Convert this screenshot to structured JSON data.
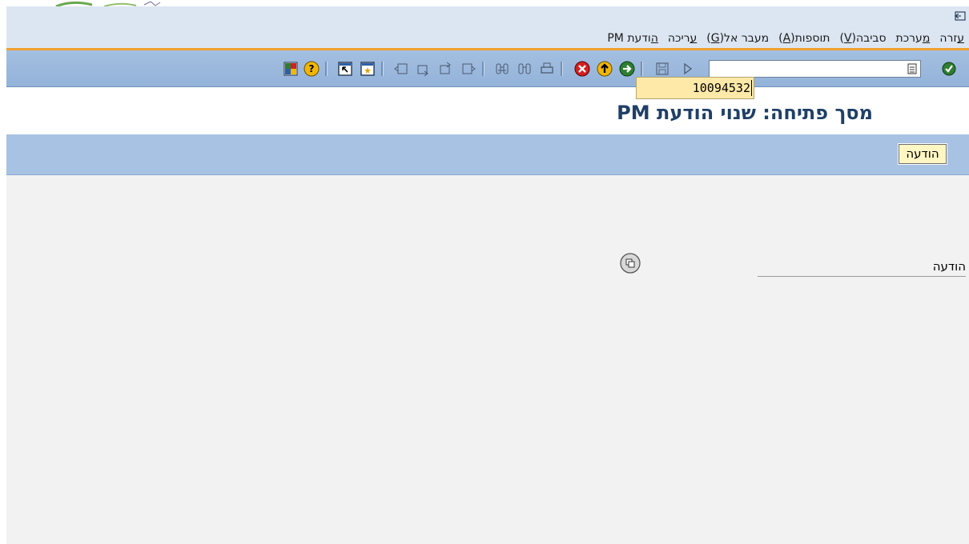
{
  "menu": {
    "items": [
      {
        "pre": "",
        "ul": "ה",
        "post": "ודעת PM"
      },
      {
        "pre": "",
        "ul": "ע",
        "post": "ריכה"
      },
      {
        "pre": "מעבר אל(",
        "ul": "G",
        "post": ")"
      },
      {
        "pre": "תוספות(",
        "ul": "A",
        "post": ")"
      },
      {
        "pre": "סביבה(",
        "ul": "V",
        "post": ")"
      },
      {
        "pre": "",
        "ul": "מ",
        "post": "ערכת"
      },
      {
        "pre": "",
        "ul": "ע",
        "post": "זרה"
      }
    ]
  },
  "toolbar": {
    "command_value": "",
    "icons": [
      "enter-icon",
      "command-dropdown-icon",
      "play-icon",
      "save-icon",
      "back-icon",
      "exit-icon",
      "cancel-icon",
      "print-icon",
      "find-icon",
      "find-next-icon",
      "first-page-icon",
      "previous-page-icon",
      "next-page-icon",
      "last-page-icon",
      "create-session-icon",
      "shortcut-icon",
      "help-icon",
      "customize-layout-icon"
    ]
  },
  "title": "מסך פתיחה: שנוי הודעת PM",
  "app_toolbar": {
    "notification_button": "הודעה"
  },
  "form": {
    "notification_label": "הודעה",
    "notification_value": "10094532"
  },
  "colors": {
    "menu_bg": "#dce6f2",
    "toolbar_bg": "#a3bfe0",
    "accent_line": "#f0a030",
    "title_color": "#1f3f66",
    "input_bg": "#ffe9a8",
    "content_bg": "#f2f2f2"
  }
}
